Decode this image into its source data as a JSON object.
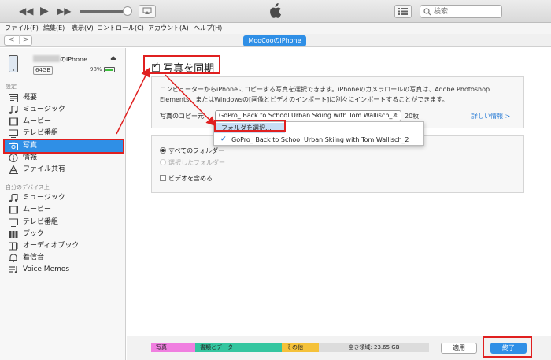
{
  "titlebar": {
    "search_placeholder": "検索"
  },
  "menu": [
    "ファイル(F)",
    "編集(E)",
    "表示(V)",
    "コントロール(C)",
    "アカウント(A)",
    "ヘルプ(H)"
  ],
  "nav": {
    "back": "<",
    "forward": ">",
    "device_tab": "MooCooのiPhone"
  },
  "device": {
    "name_suffix": "のiPhone",
    "capacity": "64GB",
    "battery": "98%"
  },
  "sidebar": {
    "settings_title": "設定",
    "settings_items": [
      {
        "label": "概要",
        "icon": "summary-icon"
      },
      {
        "label": "ミュージック",
        "icon": "music-icon"
      },
      {
        "label": "ムービー",
        "icon": "movie-icon"
      },
      {
        "label": "テレビ番組",
        "icon": "tv-icon"
      },
      {
        "label": "写真",
        "icon": "camera-icon"
      },
      {
        "label": "情報",
        "icon": "info-icon"
      },
      {
        "label": "ファイル共有",
        "icon": "app-share-icon"
      }
    ],
    "device_title": "自分のデバイス上",
    "device_items": [
      {
        "label": "ミュージック",
        "icon": "music-icon"
      },
      {
        "label": "ムービー",
        "icon": "movie-icon"
      },
      {
        "label": "テレビ番組",
        "icon": "tv-icon"
      },
      {
        "label": "ブック",
        "icon": "book-icon"
      },
      {
        "label": "オーディオブック",
        "icon": "audiobook-icon"
      },
      {
        "label": "着信音",
        "icon": "bell-icon"
      },
      {
        "label": "Voice Memos",
        "icon": "voice-memo-icon"
      }
    ]
  },
  "main": {
    "sync_label": "写真を同期",
    "description": "コンピューターからiPhoneにコピーする写真を選択できます。iPhoneのカメラロールの写真は、Adobe Photoshop Elements、またはWindowsの[画像とビデオのインポート]に別々にインポートすることができます。",
    "copy_from_label": "写真のコピー元:",
    "selected_source": "GoPro_ Back to School Urban Skiing with Tom Wallisch_2",
    "photo_count": "20枚",
    "detail_link": "詳しい情報 >",
    "dropdown": {
      "choose_folder": "フォルダを選択...",
      "checked_option": "GoPro_ Back to School Urban Skiing with Tom Wallisch_2"
    },
    "all_folders": "すべてのフォルダー",
    "selected_folders": "選択したフォルダー",
    "include_videos": "ビデオを含める"
  },
  "storage": {
    "photo": "写真",
    "books_data": "書類とデータ",
    "other": "その他",
    "free": "空き領域: 23.65 GB"
  },
  "buttons": {
    "apply": "適用",
    "done": "終了"
  },
  "colors": {
    "accent": "#2f8fe6",
    "highlight_outline": "#e02020",
    "storage_photo": "#f07fe0",
    "storage_books": "#34c6a0",
    "storage_other": "#f5c23a",
    "storage_free": "#dcdcdc"
  }
}
